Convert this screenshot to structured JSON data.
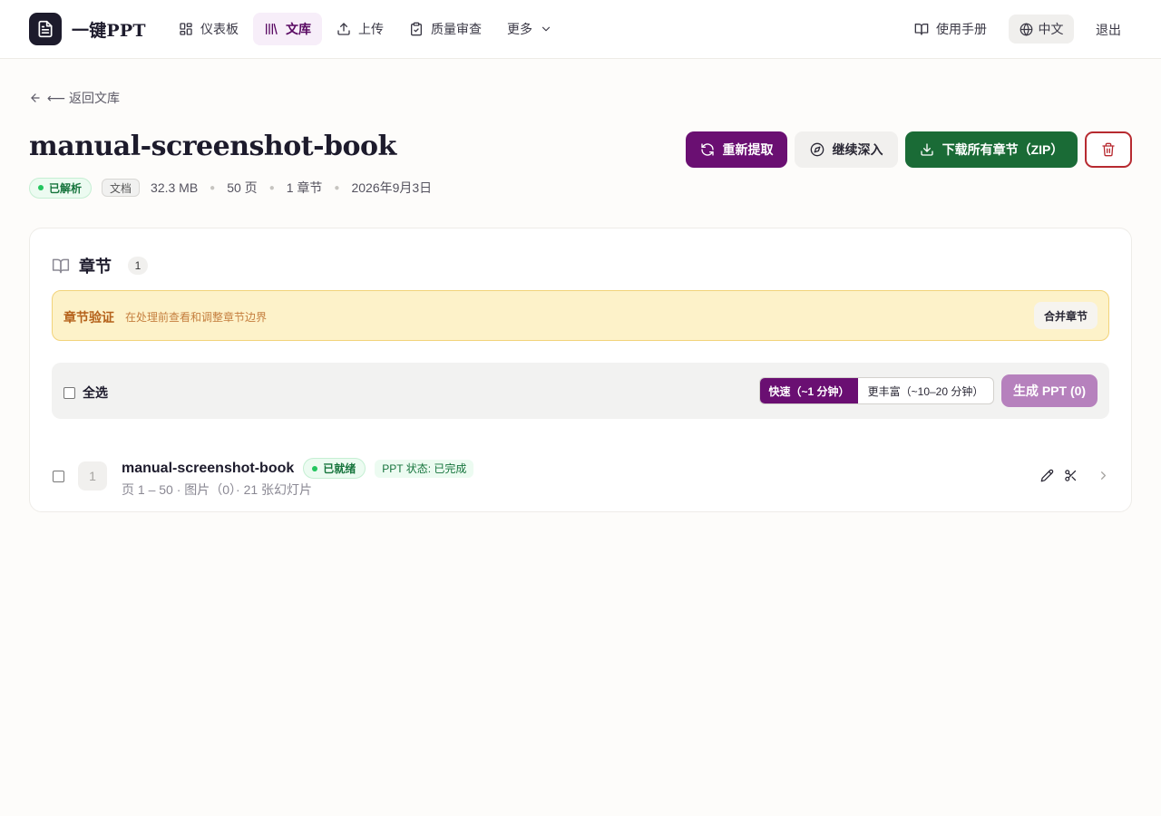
{
  "nav": {
    "brand": "一键PPT",
    "brand_icon": "document-icon",
    "items": [
      {
        "label": "仪表板",
        "icon": "dashboard-icon"
      },
      {
        "label": "文库",
        "icon": "library-icon",
        "active": true
      },
      {
        "label": "上传",
        "icon": "upload-icon"
      },
      {
        "label": "质量审查",
        "icon": "clipboard-check-icon"
      },
      {
        "label": "更多",
        "icon": "chevron-down-icon"
      }
    ],
    "manual": "使用手册",
    "language": "中文",
    "logout": "退出"
  },
  "header": {
    "back": "⟵ 返回文库",
    "title": "manual-screenshot-book",
    "status": "已解析",
    "type": "文档",
    "size": "32.3 MB",
    "pages": "50 页",
    "chapters": "1 章节",
    "date": "2026年9月3日"
  },
  "actions": {
    "reextract": "重新提取",
    "deep_dive": "继续深入",
    "download_zip": "下载所有章节（ZIP）"
  },
  "chapters_panel": {
    "title": "章节",
    "count": "1",
    "verify_title": "章节验证",
    "verify_subtitle": "在处理前查看和调整章节边界",
    "merge_button": "合并章节",
    "select_all": "全选",
    "mode_fast": "快速（~1 分钟）",
    "mode_rich": "更丰富（~10–20 分钟）",
    "generate_button": "生成 PPT (0)",
    "rows": [
      {
        "number": "1",
        "name": "manual-screenshot-book",
        "status": "已就绪",
        "ppt_status": "PPT 状态: 已完成",
        "details": "页 1 – 50 · 图片（0）· 21 张幻灯片"
      }
    ]
  },
  "colors": {
    "accent_purple": "#6a0f72",
    "success_green": "#1a6b36",
    "danger_red": "#b72a30",
    "warning_bg": "#fdf2c9"
  }
}
